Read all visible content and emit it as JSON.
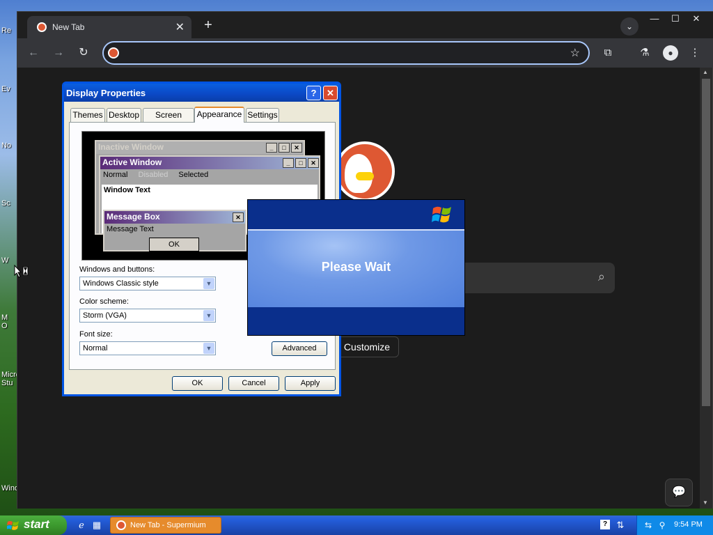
{
  "desktop": {
    "icon_labels": [
      "Re",
      "Ev",
      "No",
      "Sc",
      "W",
      "M\nO",
      "Micro\nStu",
      "Wind"
    ]
  },
  "browser": {
    "tab_title": "New Tab",
    "tab_close": "✕",
    "new_tab": "+",
    "tab_search": "⌄",
    "minimize": "—",
    "maximize": "☐",
    "close": "✕",
    "back": "←",
    "forward": "→",
    "reload": "↻",
    "address_value": "",
    "star": "☆",
    "extensions": "⧉",
    "labs": "⚗",
    "profile": "●",
    "menu": "⋮",
    "customize_label": "Customize",
    "search_glyph": "⌕",
    "chat_glyph": "💬"
  },
  "dialog": {
    "title": "Display Properties",
    "help": "?",
    "close": "✕",
    "tabs": [
      "Themes",
      "Desktop",
      "Screen Saver",
      "Appearance",
      "Settings"
    ],
    "active_tab": "Appearance",
    "preview": {
      "inactive_title": "Inactive Window",
      "active_title": "Active Window",
      "menu_items": [
        "Normal",
        "Disabled",
        "Selected"
      ],
      "window_text": "Window Text",
      "message_box_title": "Message Box",
      "message_text": "Message Text",
      "ok": "OK",
      "min": "_",
      "max": "□",
      "close": "✕"
    },
    "windows_buttons_label": "Windows and buttons:",
    "windows_buttons_value": "Windows Classic style",
    "color_scheme_label": "Color scheme:",
    "color_scheme_value": "Storm (VGA)",
    "font_size_label": "Font size:",
    "font_size_value": "Normal",
    "advanced_label": "Advanced",
    "ok_label": "OK",
    "cancel_label": "Cancel",
    "apply_label": "Apply",
    "arrow": "▼"
  },
  "wait": {
    "text": "Please Wait"
  },
  "taskbar": {
    "start_label": "start",
    "task_title": "New Tab - Supermium",
    "clock": "9:54 PM",
    "help_icon": "?"
  },
  "colors": {
    "xp_blue": "#0054e3",
    "ddg_orange": "#de5833",
    "active_tab_accent": "#e68b2c"
  }
}
